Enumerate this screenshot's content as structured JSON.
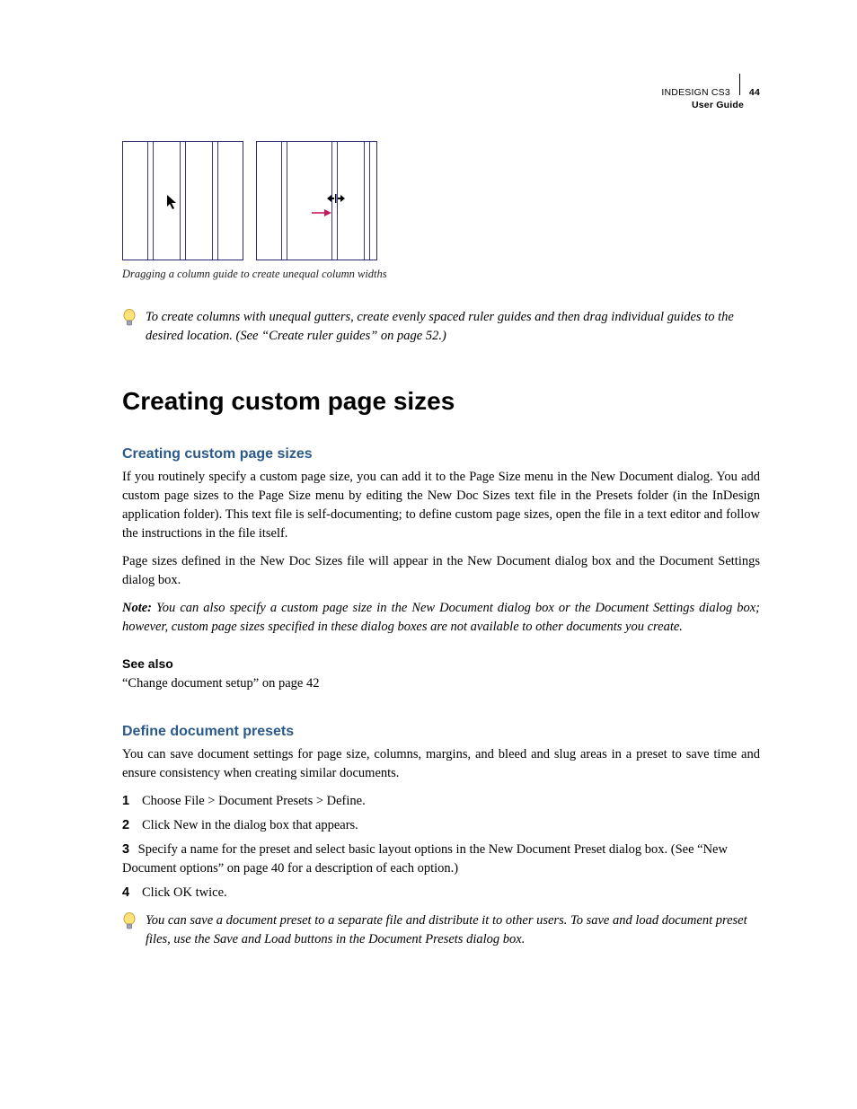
{
  "header": {
    "product": "INDESIGN CS3",
    "page_number": "44",
    "subtitle": "User Guide"
  },
  "figure": {
    "caption": "Dragging a column guide to create unequal column widths"
  },
  "tip1": "To create columns with unequal gutters, create evenly spaced ruler guides and then drag individual guides to the desired location. (See “Create ruler guides” on page 52.)",
  "h1": "Creating custom page sizes",
  "section1": {
    "heading": "Creating custom page sizes",
    "p1": "If you routinely specify a custom page size, you can add it to the Page Size menu in the New Document dialog. You add custom page sizes to the Page Size menu by editing the New Doc Sizes text file in the Presets folder (in the InDesign application folder). This text file is self-documenting; to define custom page sizes, open the file in a text editor and follow the instructions in the file itself.",
    "p2": "Page sizes defined in the New Doc Sizes file will appear in the New Document dialog box and the Document Settings dialog box.",
    "note_label": "Note:",
    "note_body": " You can also specify a custom page size in the New Document dialog box or the Document Settings dialog box; however, custom page sizes specified in these dialog boxes are not available to other documents you create."
  },
  "see_also": {
    "heading": "See also",
    "item": "“Change document setup” on page 42"
  },
  "section2": {
    "heading": "Define document presets",
    "intro": "You can save document settings for page size, columns, margins, and bleed and slug areas in a preset to save time and ensure consistency when creating similar documents.",
    "steps": [
      {
        "n": "1",
        "t": "Choose File > Document Presets > Define."
      },
      {
        "n": "2",
        "t": "Click New in the dialog box that appears."
      },
      {
        "n": "3",
        "t": "Specify a name for the preset and select basic layout options in the New Document Preset dialog box. (See “New Document options” on page 40 for a description of each option.)"
      },
      {
        "n": "4",
        "t": "Click OK twice."
      }
    ],
    "tip": "You can save a document preset to a separate file and distribute it to other users. To save and load document preset files, use the Save and Load buttons in the Document Presets dialog box."
  }
}
